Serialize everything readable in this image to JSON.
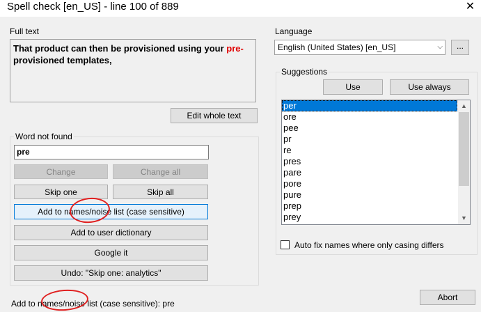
{
  "window": {
    "title": "Spell check [en_US] - line 100 of 889",
    "close_glyph": "✕"
  },
  "full_text": {
    "label": "Full text",
    "line1_prefix": "That product can then be provisioned using your ",
    "line1_error": "pre-",
    "line2": "provisioned templates,"
  },
  "edit_whole_text_label": "Edit whole text",
  "word_not_found": {
    "label": "Word not found",
    "value": "pre",
    "change_label": "Change",
    "change_all_label": "Change all",
    "skip_one_label": "Skip one",
    "skip_all_label": "Skip all",
    "add_names_label": "Add to names/noise list (case sensitive)",
    "add_user_dict_label": "Add to user dictionary",
    "google_label": "Google it",
    "undo_label": "Undo: \"Skip one: analytics\""
  },
  "language": {
    "label": "Language",
    "selected": "English (United States) [en_US]",
    "browse_label": "..."
  },
  "suggestions": {
    "label": "Suggestions",
    "use_label": "Use",
    "use_always_label": "Use always",
    "items": [
      "per",
      "ore",
      "pee",
      "pr",
      "re",
      "pres",
      "pare",
      "pore",
      "pure",
      "prep",
      "prey"
    ],
    "selected_index": 0
  },
  "auto_fix": {
    "label": "Auto fix names where only casing differs",
    "checked": false
  },
  "status_text": "Add to names/noise list (case sensitive): pre",
  "abort_label": "Abort",
  "colors": {
    "error_text": "#e00000",
    "selection": "#0078d7",
    "annotation_circle": "#e02020"
  }
}
